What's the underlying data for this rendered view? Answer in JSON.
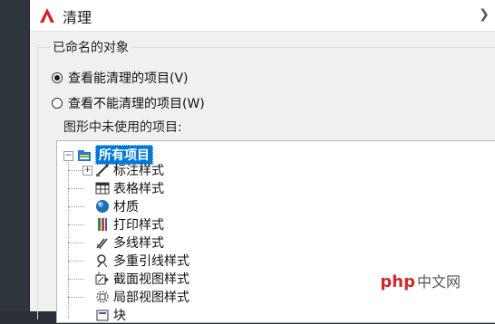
{
  "window": {
    "title": "清理"
  },
  "group": {
    "label": "已命名的对象"
  },
  "options": [
    {
      "label": "查看能清理的项目(V)",
      "checked": true
    },
    {
      "label": "查看不能清理的项目(W)",
      "checked": false
    }
  ],
  "tree": {
    "heading": "图形中未使用的项目:",
    "root": {
      "label": "所有项目"
    },
    "items": [
      {
        "label": "标注样式",
        "icon": "dimension-style-icon",
        "expandable": true
      },
      {
        "label": "表格样式",
        "icon": "table-style-icon",
        "expandable": false
      },
      {
        "label": "材质",
        "icon": "material-sphere-icon",
        "expandable": false
      },
      {
        "label": "打印样式",
        "icon": "plot-style-icon",
        "expandable": false
      },
      {
        "label": "多线样式",
        "icon": "multiline-style-icon",
        "expandable": false
      },
      {
        "label": "多重引线样式",
        "icon": "mleader-style-icon",
        "expandable": false
      },
      {
        "label": "截面视图样式",
        "icon": "section-view-style-icon",
        "expandable": false
      },
      {
        "label": "局部视图样式",
        "icon": "detail-view-style-icon",
        "expandable": false
      },
      {
        "label": "块",
        "icon": "block-icon",
        "expandable": false
      }
    ]
  },
  "watermark": {
    "brand": "php",
    "text": "中文网"
  }
}
